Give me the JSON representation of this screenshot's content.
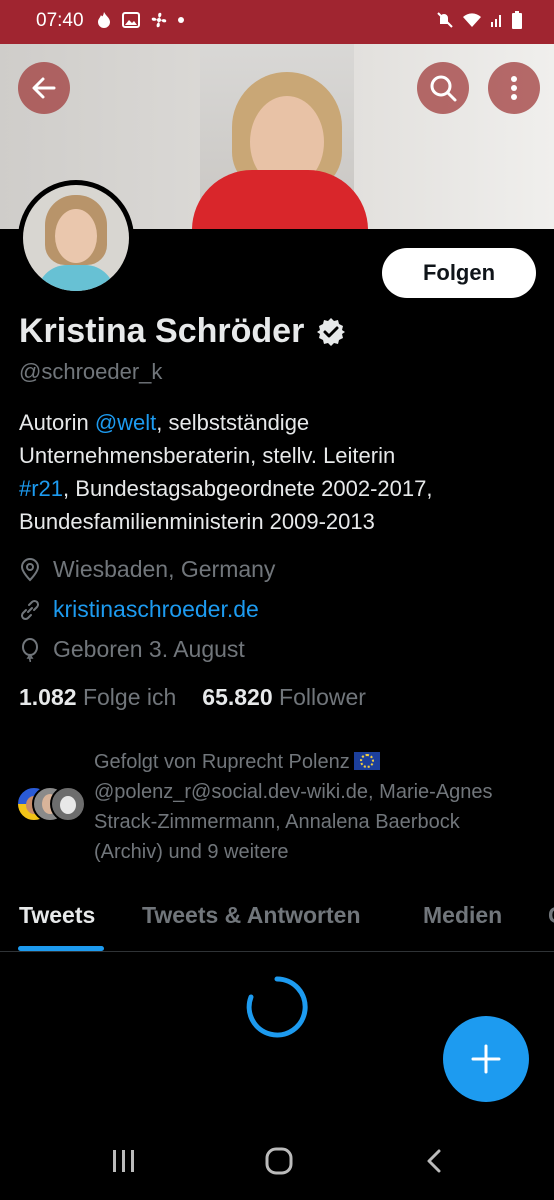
{
  "status_bar": {
    "time": "07:40"
  },
  "profile": {
    "name": "Kristina Schröder",
    "handle": "@schroeder_k",
    "follow_label": "Folgen",
    "bio": {
      "line1_pre": "Autorin ",
      "line1_link": "@welt",
      "line1_post": ", selbstständige",
      "line2": "Unternehmensberaterin, stellv. Leiterin",
      "line3_link": "#r21",
      "line3_post": ", Bundestagsabgeordnete 2002-2017,",
      "line4": "Bundesfamilienministerin 2009-2013"
    },
    "location": "Wiesbaden, Germany",
    "website": "kristinaschroeder.de",
    "birthday": "Geboren 3. August",
    "following_count": "1.082",
    "following_label": "Folge ich",
    "followers_count": "65.820",
    "followers_label": "Follower",
    "followed_by": {
      "line1": "Gefolgt von Ruprecht Polenz",
      "line2": "@polenz_r@social.dev-wiki.de, Marie-Agnes",
      "line3": "Strack-Zimmermann, Annalena Baerbock",
      "line4": "(Archiv) und 9 weitere"
    }
  },
  "tabs": [
    "Tweets",
    "Tweets & Antworten",
    "Medien",
    "G"
  ],
  "colors": {
    "accent": "#1d9bf0",
    "status_bar": "#a02530",
    "background": "#000000"
  }
}
